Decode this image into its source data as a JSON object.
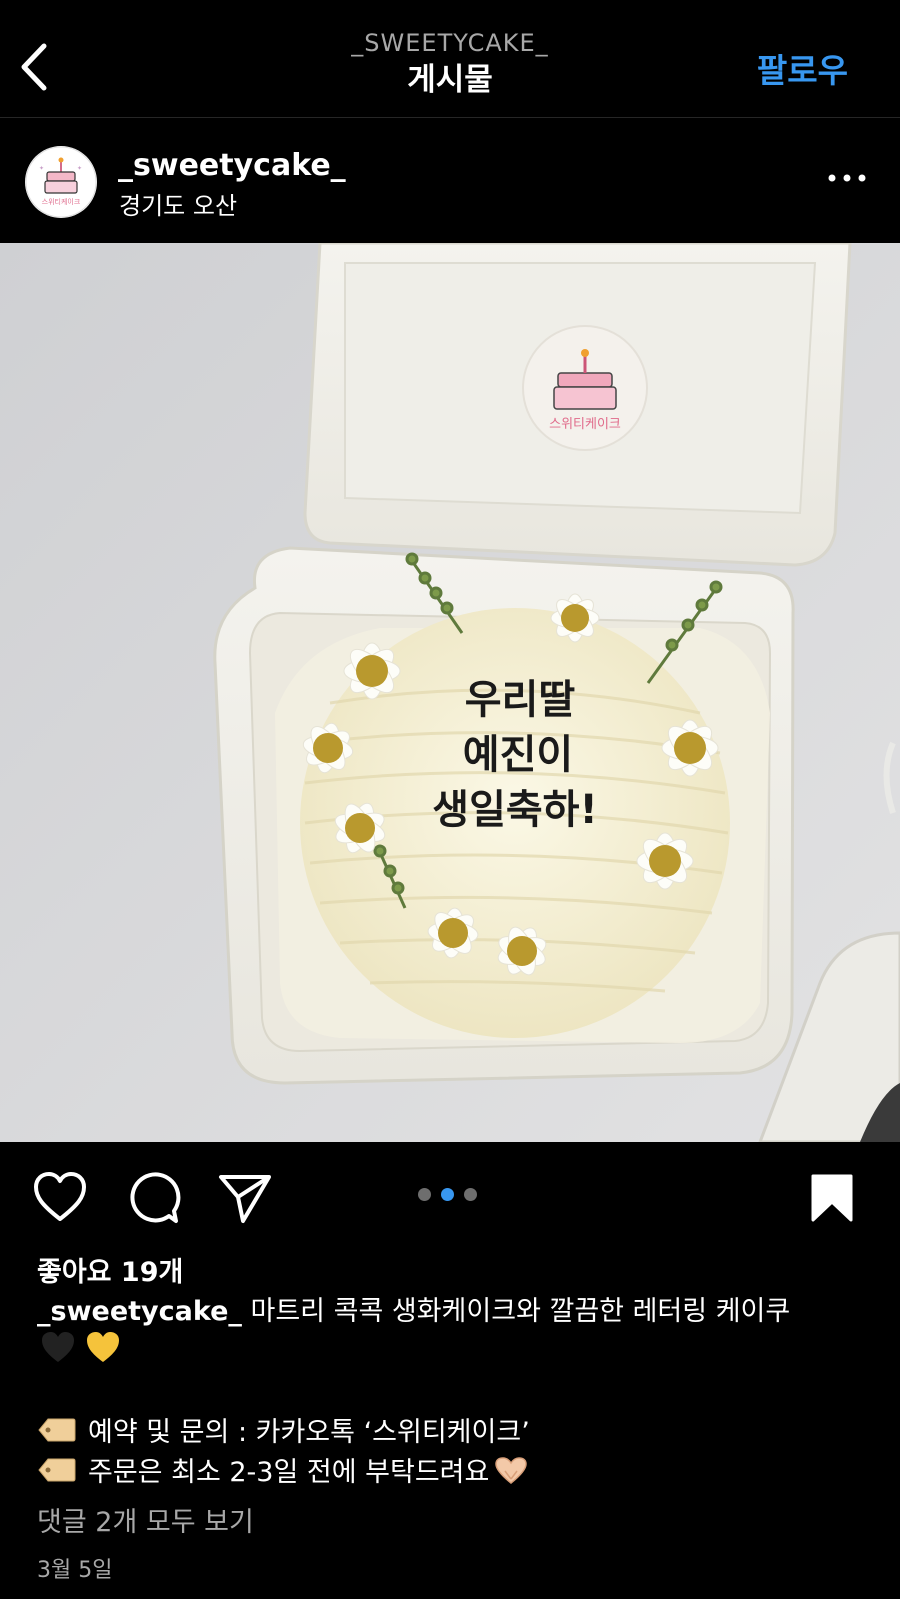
{
  "header": {
    "back_icon": "chevron-left-icon",
    "subtitle": "_SWEETYCAKE_",
    "title": "게시물",
    "follow_label": "팔로우",
    "follow_color": "#3897f0"
  },
  "post": {
    "username": "_sweetycake_",
    "location": "경기도 오산",
    "avatar_icon": "cake-logo-avatar",
    "more_icon": "more-horizontal-icon",
    "avatar_logo_text": "스위티케이크"
  },
  "photo": {
    "cake_lettering": [
      "우리딸",
      "예진이",
      "생일축하!"
    ],
    "sticker_text": "스위티케이크"
  },
  "actions": {
    "like_icon": "heart-icon",
    "comment_icon": "comment-icon",
    "share_icon": "send-icon",
    "save_icon": "bookmark-icon",
    "carousel": {
      "total": 3,
      "active": 2
    }
  },
  "likes": "좋아요 19개",
  "caption": {
    "user": "_sweetycake_",
    "text": " 마트리 콕콕 생화케이크와 깔끔한 레터링 케이쿠",
    "emojis": [
      "black-heart",
      "yellow-heart"
    ],
    "line1": "예약 및 문의 : 카카오톡 ‘스위티케이크’",
    "line2": "주문은 최소 2-3일 전에 부탁드려요"
  },
  "comments_link": "댓글 2개 모두 보기",
  "date": "3월 5일"
}
